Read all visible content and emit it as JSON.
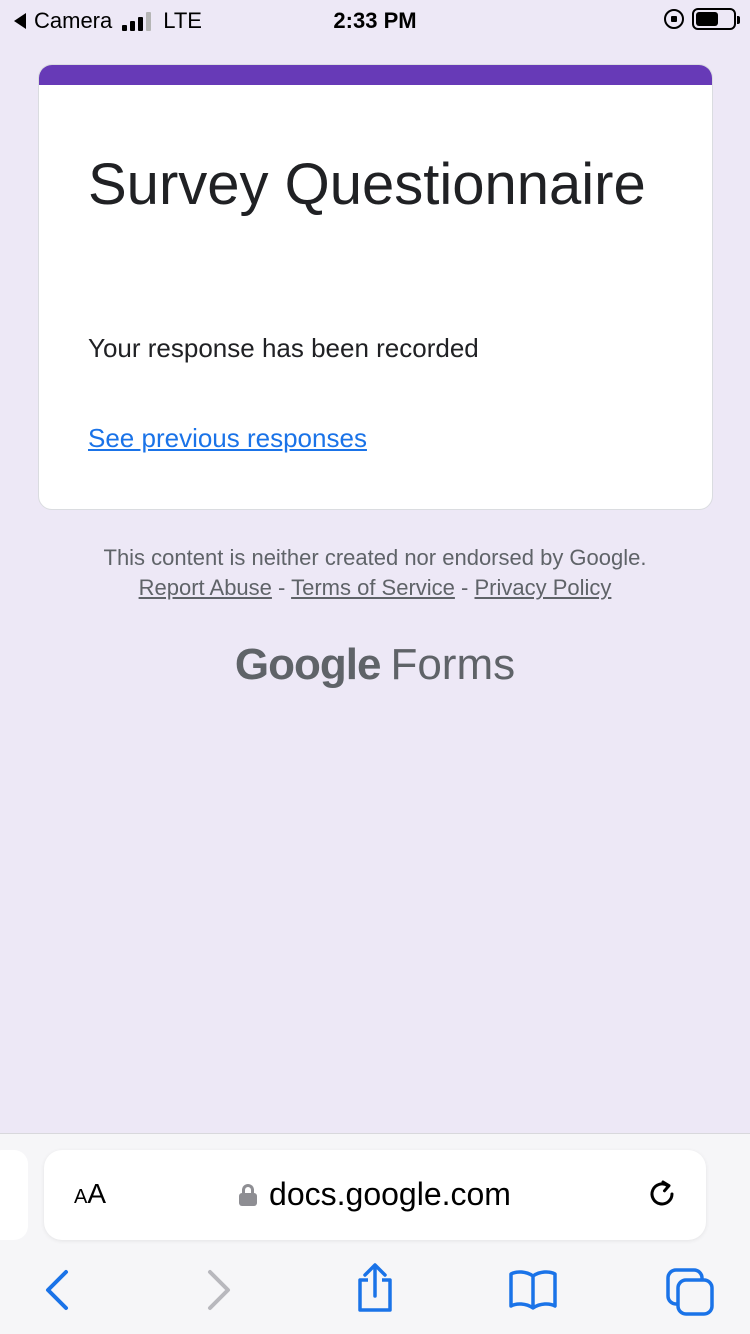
{
  "status_bar": {
    "back_app": "Camera",
    "network": "LTE",
    "time": "2:33 PM"
  },
  "form": {
    "title": "Survey Questionnaire",
    "confirmation": "Your response has been recorded",
    "previous_link": "See previous responses",
    "accent_color": "#673ab7"
  },
  "footer": {
    "disclaimer": "This content is neither created nor endorsed by Google.",
    "links": [
      "Report Abuse",
      "Terms of Service",
      "Privacy Policy"
    ],
    "separator": "-",
    "brand_google": "Google",
    "brand_product": "Forms"
  },
  "browser": {
    "text_size_label_small": "A",
    "text_size_label_large": "A",
    "url": "docs.google.com",
    "toolbar_icons": [
      "back-icon",
      "forward-icon",
      "share-icon",
      "bookmarks-icon",
      "tabs-icon"
    ],
    "accent_color": "#1a73e8"
  }
}
